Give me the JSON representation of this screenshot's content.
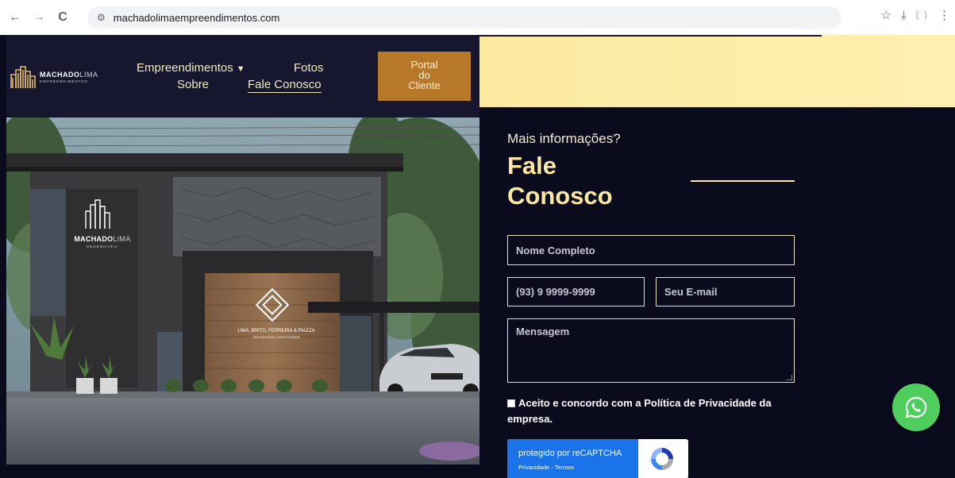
{
  "browser": {
    "back_icon": "←",
    "forward_icon": "→",
    "reload_icon": "C",
    "site_settings_icon": "⚙",
    "url": "machadolimaempreendimentos.com",
    "bookmark_icon": "☆",
    "download_icon": "⤓",
    "extension_text": "( )",
    "menu_icon": "⋮"
  },
  "header": {
    "logo": {
      "brand_bold": "MACHADO",
      "brand_thin": "LIMA",
      "sub": "EMPREENDIMENTOS"
    },
    "menu": {
      "empreendimentos": "Empreendimentos",
      "fotos": "Fotos",
      "sobre": "Sobre",
      "fale_conosco": "Fale Conosco"
    },
    "caret_icon": "▼",
    "portal": {
      "line1": "Portal",
      "line2": "do",
      "line3": "Cliente"
    }
  },
  "hero": {
    "sign_brand_bold": "MACHADO",
    "sign_brand_thin": "LIMA",
    "sign_sub": "ENGENHARIA",
    "office_line1": "LIMA, BRITO, FERREIRA & PIAZZA",
    "office_line2": "ADVOGADOS ASSOCIADOS"
  },
  "form": {
    "pre_title": "Mais informações?",
    "title_line1": "Fale",
    "title_line2": "Conosco",
    "name_placeholder": "Nome Completo",
    "phone_placeholder": "(93) 9 9999-9999",
    "email_placeholder": "Seu E-mail",
    "message_placeholder": "Mensagem",
    "consent_text": "Aceito e concordo com a Política de Privacidade da empresa.",
    "consent_checked": false
  },
  "recaptcha": {
    "title": "protegido por reCAPTCHA",
    "links": "Privacidade - Termos"
  },
  "colors": {
    "gold": "#fbe79f",
    "header_bg": "#16162f",
    "page_bg": "#0a0b1c",
    "portal_btn": "#b8782a",
    "whatsapp": "#4fce5d"
  }
}
